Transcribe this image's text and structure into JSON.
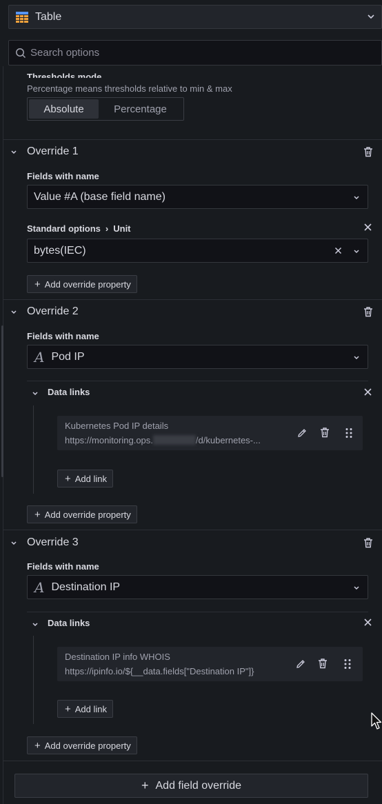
{
  "header": {
    "viz_label": "Table",
    "search_placeholder": "Search options"
  },
  "thresholds": {
    "title_cut": "Thresholds mode",
    "description": "Percentage means thresholds relative to min & max",
    "options": [
      "Absolute",
      "Percentage"
    ],
    "selected": "Absolute"
  },
  "overrides": [
    {
      "title": "Override 1",
      "fields_label": "Fields with name",
      "field_value": "Value #A (base field name)",
      "property_path_a": "Standard options",
      "property_path_sep": "›",
      "property_path_b": "Unit",
      "unit_value": "bytes(IEC)",
      "add_property_label": "Add override property"
    },
    {
      "title": "Override 2",
      "fields_label": "Fields with name",
      "field_value": "Pod IP",
      "data_links_label": "Data links",
      "link_title": "Kubernetes Pod IP details",
      "link_url_a": "https://monitoring.ops.",
      "link_url_b": "/d/kubernetes-...",
      "add_link_label": "Add link",
      "add_property_label": "Add override property"
    },
    {
      "title": "Override 3",
      "fields_label": "Fields with name",
      "field_value": "Destination IP",
      "data_links_label": "Data links",
      "link_title": "Destination IP info WHOIS",
      "link_url": "https://ipinfo.io/${__data.fields[\"Destination IP\"]}",
      "add_link_label": "Add link",
      "add_property_label": "Add override property"
    }
  ],
  "footer": {
    "add_field_override_label": "Add field override"
  },
  "colors": {
    "background": "#181b1f",
    "input_background": "#111217",
    "card_background": "#22252b",
    "text": "#d8d9e0",
    "muted_text": "#9fa1ad"
  }
}
